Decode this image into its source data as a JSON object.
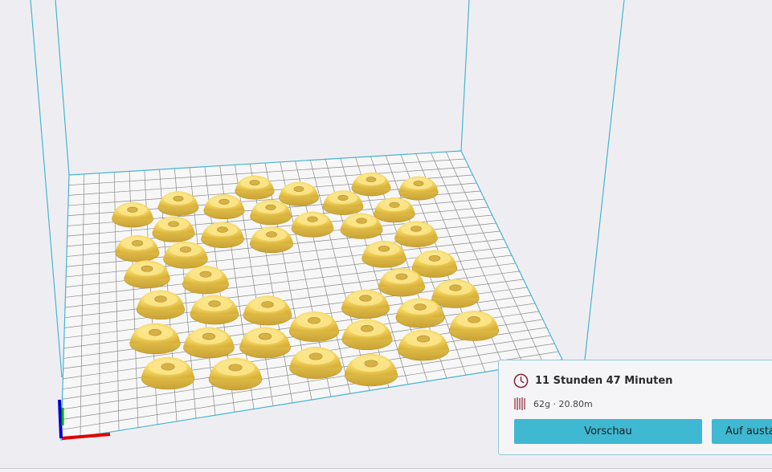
{
  "print_summary": {
    "time_icon": "clock-icon",
    "print_time": "11 Stunden 47 Minuten",
    "material_icon": "filament-spool-icon",
    "material": "62g · 20.80m",
    "preview_label": "Vorschau",
    "second_button_label": "Auf austau"
  },
  "colors": {
    "background": "#eeeef2",
    "build_volume_lines": "#46b4d2",
    "grid_lines": "#8a8a8a",
    "plate": "#f7f7f7",
    "model": "#f5d864",
    "accent_button": "#3fb8d1",
    "icon_red": "#8a2233",
    "axis_x": "#e00000",
    "axis_y": "#00b000",
    "axis_z": "#0000d8"
  }
}
